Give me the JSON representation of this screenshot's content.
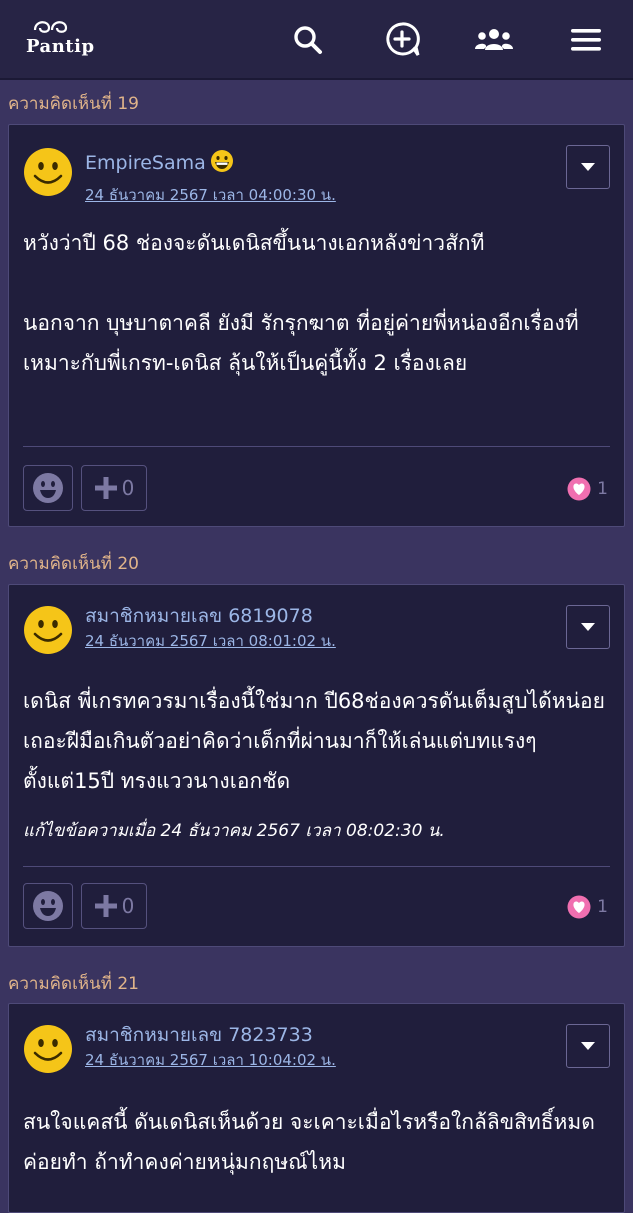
{
  "header": {
    "logo_text": "Pantip",
    "icons": [
      "search-icon",
      "new-topic-icon",
      "community-icon",
      "menu-icon"
    ]
  },
  "comments": [
    {
      "label": "ความคิดเห็นที่ 19",
      "username": "EmpireSama",
      "user_badge": "grinning-emoji",
      "timestamp": "24 ธันวาคม 2567 เวลา 04:00:30 น.",
      "body": [
        "หวังว่าปี 68 ช่องจะดันเดนิสขึ้นนางเอกหลังข่าวสักที",
        "",
        "นอกจาก บุษบาตาคลี ยังมี รักรุกฆาต ที่อยู่ค่ายพี่หน่องอีกเรื่องที่เหมาะกับพี่เกรท-เดนิส ลุ้นให้เป็นคู่นี้ทั้ง 2 เรื่องเลย"
      ],
      "edited": "",
      "plus_count": "0",
      "heart_count": "1"
    },
    {
      "label": "ความคิดเห็นที่ 20",
      "username": "สมาชิกหมายเลข 6819078",
      "timestamp": "24 ธันวาคม 2567 เวลา 08:01:02 น.",
      "body": [
        "เดนิส พี่เกรทควรมาเรื่องนี้ใช่มาก ปี68ช่องควรดันเต็มสูบได้หน่อยเถอะฝีมือเกินตัวอย่าคิดว่าเด็กที่ผ่านมาก็ให้เล่นแต่บทแรงๆตั้งแต่15ปี ทรงแววนางเอกชัด"
      ],
      "edited": "แก้ไขข้อความเมื่อ 24 ธันวาคม 2567 เวลา 08:02:30 น.",
      "plus_count": "0",
      "heart_count": "1"
    },
    {
      "label": "ความคิดเห็นที่ 21",
      "username": "สมาชิกหมายเลข 7823733",
      "timestamp": "24 ธันวาคม 2567 เวลา 10:04:02 น.",
      "body": [
        "สนใจแคสนี้ ดันเดนิสเห็นด้วย จะเคาะเมื่อไรหรือใกล้ลิขสิทธิ์หมดค่อยทำ ถ้าทำคงค่ายหนุ่มกฤษณ์ไหม"
      ]
    }
  ],
  "colors": {
    "page_bg": "#3a3460",
    "card_bg": "#201e3c",
    "header_bg": "#272445",
    "section_label": "#e0b48a",
    "username": "#9cb6e6",
    "heart": "#f06fb0"
  }
}
